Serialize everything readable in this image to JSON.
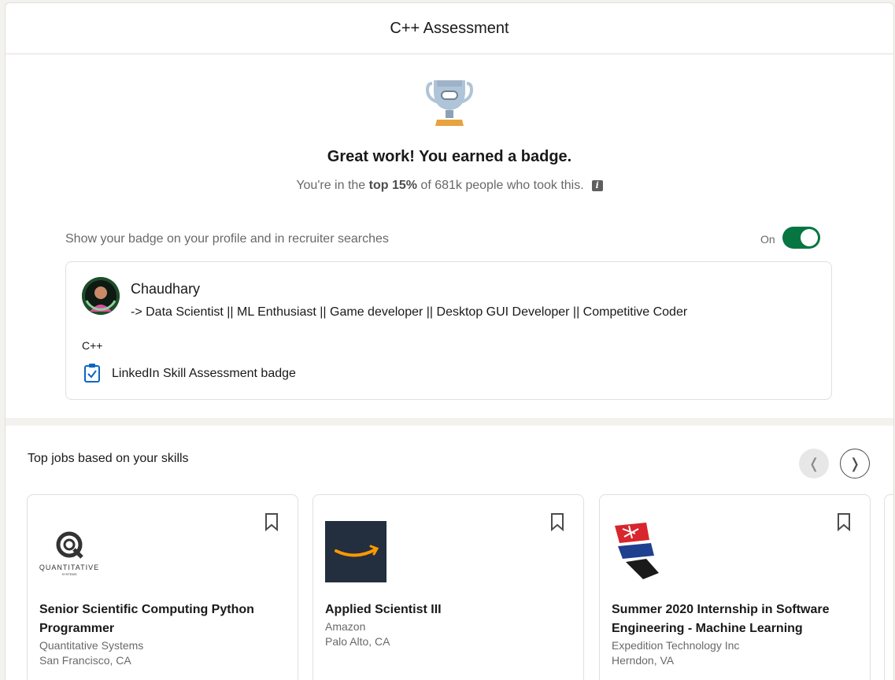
{
  "header": {
    "title": "C++ Assessment"
  },
  "result": {
    "headline": "Great work! You earned a badge.",
    "sub_prefix": "You're in the ",
    "sub_bold": "top 15%",
    "sub_suffix": " of 681k people who took this.",
    "info_glyph": "i"
  },
  "badge_toggle": {
    "label": "Show your badge on your profile and in recruiter searches",
    "state_text": "On",
    "on": true
  },
  "profile_card": {
    "name": "Chaudhary",
    "headline": "-> Data Scientist || ML Enthusiast || Game developer || Desktop GUI Developer || Competitive Coder",
    "skill": "C++",
    "badge_label": "LinkedIn Skill Assessment badge"
  },
  "jobs": {
    "section_title": "Top jobs based on your skills",
    "prev_glyph": "❬",
    "next_glyph": "❭",
    "items": [
      {
        "title": "Senior Scientific Computing Python Programmer",
        "company": "Quantitative Systems",
        "location": "San Francisco, CA",
        "logo_text": "QUANTITATIVE",
        "logo_subtext": "SYSTEMS"
      },
      {
        "title": "Applied Scientist III",
        "company": "Amazon",
        "location": "Palo Alto, CA"
      },
      {
        "title": "Summer 2020 Internship in Software Engineering - Machine Learning",
        "company": "Expedition Technology Inc",
        "location": "Herndon, VA"
      }
    ]
  },
  "colors": {
    "toggle_on": "#057642",
    "link_blue": "#0a66c2",
    "amazon_bg": "#232f3e",
    "amazon_orange": "#ff9900"
  }
}
